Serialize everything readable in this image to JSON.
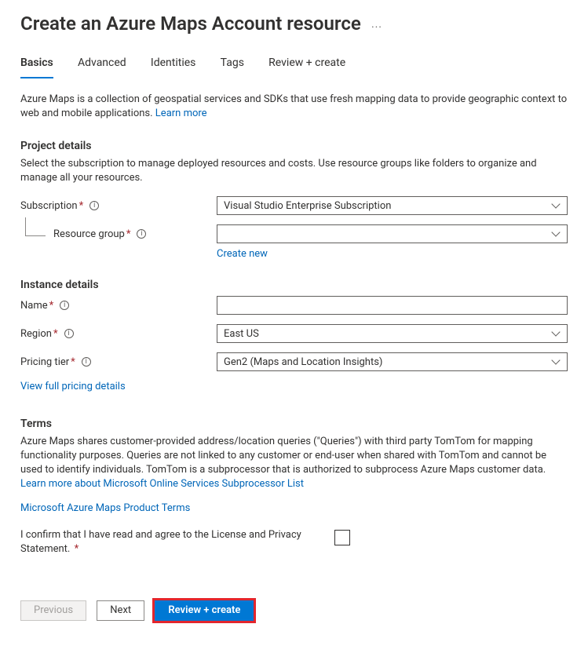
{
  "title": "Create an Azure Maps Account resource",
  "tabs": [
    "Basics",
    "Advanced",
    "Identities",
    "Tags",
    "Review + create"
  ],
  "intro": {
    "text": "Azure Maps is a collection of geospatial services and SDKs that use fresh mapping data to provide geographic context to web and mobile applications. ",
    "link": "Learn more"
  },
  "project": {
    "heading": "Project details",
    "desc": "Select the subscription to manage deployed resources and costs. Use resource groups like folders to organize and manage all your resources.",
    "subscription_label": "Subscription",
    "subscription_value": "Visual Studio Enterprise Subscription",
    "resource_group_label": "Resource group",
    "resource_group_value": "",
    "create_new": "Create new"
  },
  "instance": {
    "heading": "Instance details",
    "name_label": "Name",
    "name_value": "",
    "region_label": "Region",
    "region_value": "East US",
    "pricing_label": "Pricing tier",
    "pricing_value": "Gen2 (Maps and Location Insights)",
    "pricing_link": "View full pricing details"
  },
  "terms": {
    "heading": "Terms",
    "body": "Azure Maps shares customer-provided address/location queries (\"Queries\") with third party TomTom for mapping functionality purposes. Queries are not linked to any customer or end-user when shared with TomTom and cannot be used to identify individuals. TomTom is a subprocessor that is authorized to subprocess Azure Maps customer data. ",
    "link1": "Learn more about Microsoft Online Services Subprocessor List",
    "link2": "Microsoft Azure Maps Product Terms",
    "confirm": "I confirm that I have read and agree to the License and Privacy Statement."
  },
  "footer": {
    "previous": "Previous",
    "next": "Next",
    "review": "Review + create"
  }
}
